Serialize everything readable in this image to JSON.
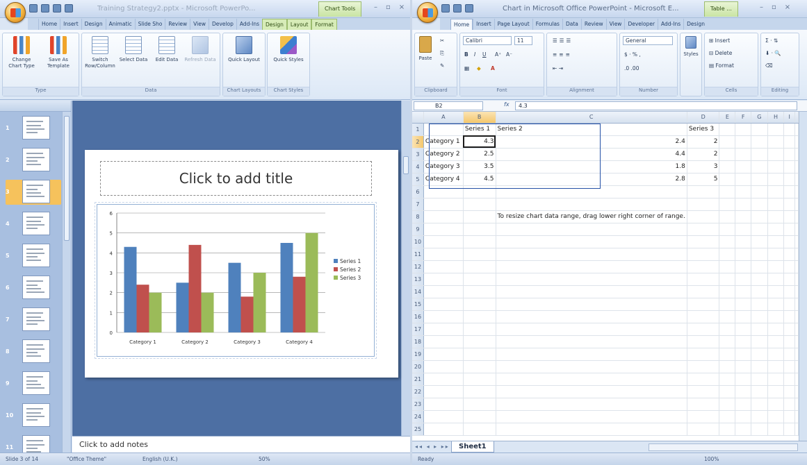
{
  "ppt": {
    "title": "Training Strategy2.pptx - Microsoft PowerPo...",
    "context_tab": "Chart Tools",
    "tabs": [
      "Home",
      "Insert",
      "Design",
      "Animatic",
      "Slide Sho",
      "Review",
      "View",
      "Develop",
      "Add-Ins",
      "Design",
      "Layout",
      "Format"
    ],
    "ribbon": {
      "type_group": "Type",
      "change_chart_type": "Change Chart Type",
      "save_as_template": "Save As Template",
      "data_group": "Data",
      "switch_row_column": "Switch Row/Column",
      "select_data": "Select Data",
      "edit_data": "Edit Data",
      "refresh_data": "Refresh Data",
      "layouts_group": "Chart Layouts",
      "quick_layout": "Quick Layout",
      "styles_group": "Chart Styles",
      "quick_styles": "Quick Styles"
    },
    "thumb_numbers": [
      "1",
      "2",
      "3",
      "4",
      "5",
      "6",
      "7",
      "8",
      "9",
      "10",
      "11"
    ],
    "slide_title_placeholder": "Click to add title",
    "notes_placeholder": "Click to add notes",
    "status": {
      "slide": "Slide 3 of 14",
      "theme": "\"Office Theme\"",
      "language": "English (U.K.)",
      "zoom": "50%"
    }
  },
  "chart_data": {
    "type": "bar",
    "categories": [
      "Category 1",
      "Category 2",
      "Category 3",
      "Category 4"
    ],
    "series": [
      {
        "name": "Series 1",
        "values": [
          4.3,
          2.5,
          3.5,
          4.5
        ],
        "color": "#4f81bd"
      },
      {
        "name": "Series 2",
        "values": [
          2.4,
          4.4,
          1.8,
          2.8
        ],
        "color": "#c0504d"
      },
      {
        "name": "Series 3",
        "values": [
          2,
          2,
          3,
          5
        ],
        "color": "#9bbb59"
      }
    ],
    "ylim": [
      0,
      6
    ],
    "yticks": [
      "0",
      "1",
      "2",
      "3",
      "4",
      "5",
      "6"
    ],
    "grid": true,
    "legend": "right"
  },
  "excel": {
    "title": "Chart in Microsoft Office PowerPoint - Microsoft E...",
    "context_tab": "Table ...",
    "tabs": [
      "Home",
      "Insert",
      "Page Layout",
      "Formulas",
      "Data",
      "Review",
      "View",
      "Developer",
      "Add-Ins",
      "Design"
    ],
    "ribbon": {
      "paste": "Paste",
      "clipboard": "Clipboard",
      "font_name": "Calibri",
      "font_size": "11",
      "font": "Font",
      "alignment": "Alignment",
      "number_format": "General",
      "number": "Number",
      "styles": "Styles",
      "insert": "Insert",
      "delete": "Delete",
      "format": "Format",
      "cells": "Cells",
      "editing": "Editing"
    },
    "name_box": "B2",
    "fx": "fx",
    "formula": "4.3",
    "columns": [
      "A",
      "B",
      "C",
      "D",
      "E",
      "F",
      "G",
      "H",
      "I"
    ],
    "rows": [
      [
        "",
        "Series 1",
        "Series 2",
        "Series 3"
      ],
      [
        "Category 1",
        "4.3",
        "2.4",
        "2"
      ],
      [
        "Category 2",
        "2.5",
        "4.4",
        "2"
      ],
      [
        "Category 3",
        "3.5",
        "1.8",
        "3"
      ],
      [
        "Category 4",
        "4.5",
        "2.8",
        "5"
      ]
    ],
    "row_count": 25,
    "note": "To resize chart data range, drag lower right corner of range.",
    "sheet_tab": "Sheet1",
    "status": {
      "ready": "Ready",
      "zoom": "100%"
    }
  }
}
